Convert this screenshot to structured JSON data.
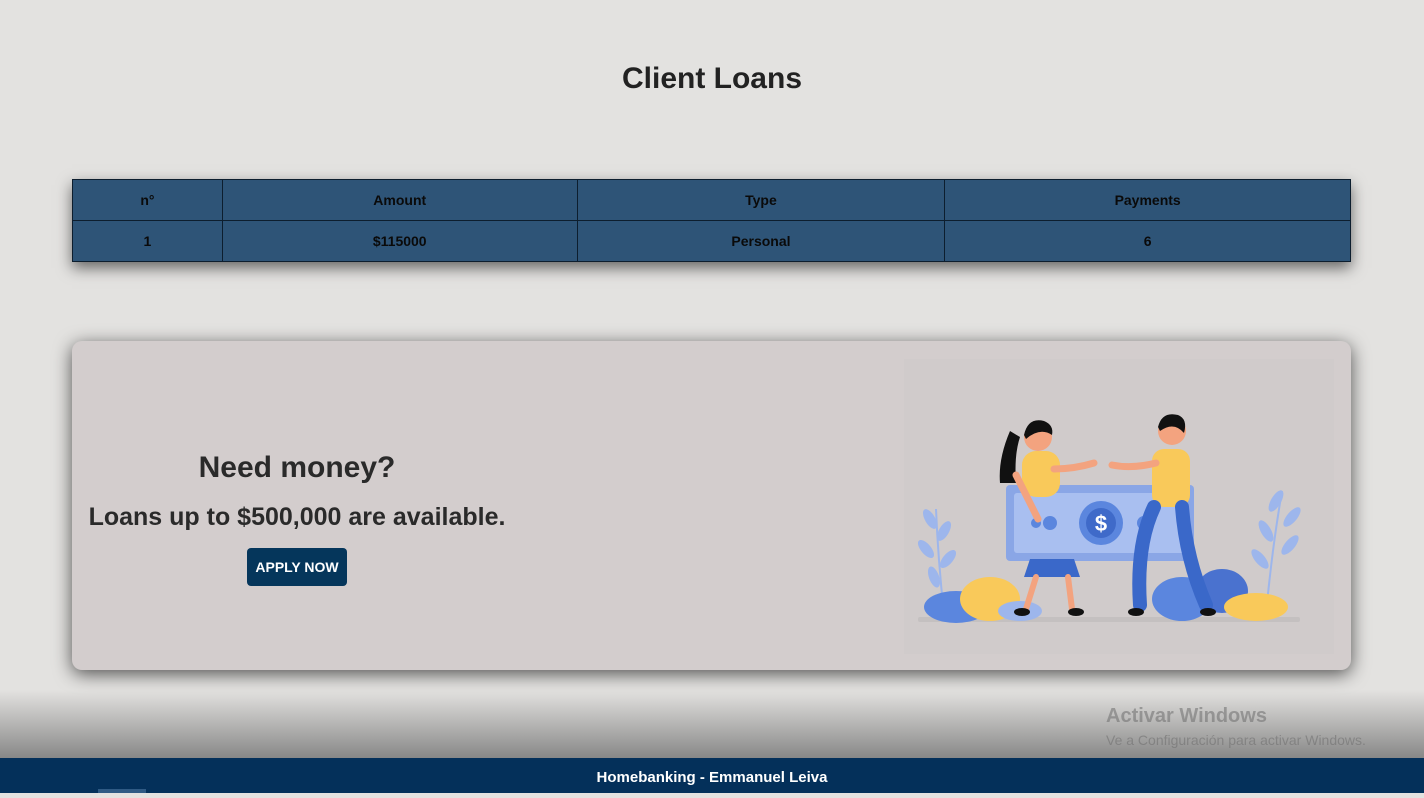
{
  "page": {
    "title": "Client Loans"
  },
  "loans_table": {
    "headers": [
      "n°",
      "Amount",
      "Type",
      "Payments"
    ],
    "rows": [
      {
        "number": "1",
        "amount": "$115000",
        "type": "Personal",
        "payments": "6"
      }
    ]
  },
  "promo": {
    "heading": "Need money?",
    "subheading": "Loans up to $500,000 are available.",
    "button_label": "APPLY NOW",
    "illustration": "two-people-holding-dollar-bill-illustration"
  },
  "watermark": {
    "line1": "Activar Windows",
    "line2": "Ve a Configuración para activar Windows."
  },
  "footer": {
    "text": "Homebanking - Emmanuel Leiva"
  },
  "colors": {
    "background": "#e3e2e0",
    "table_fill": "#2e5477",
    "card_fill": "#d3cdcd",
    "button_fill": "#05365b",
    "footer_fill": "#04305a"
  }
}
